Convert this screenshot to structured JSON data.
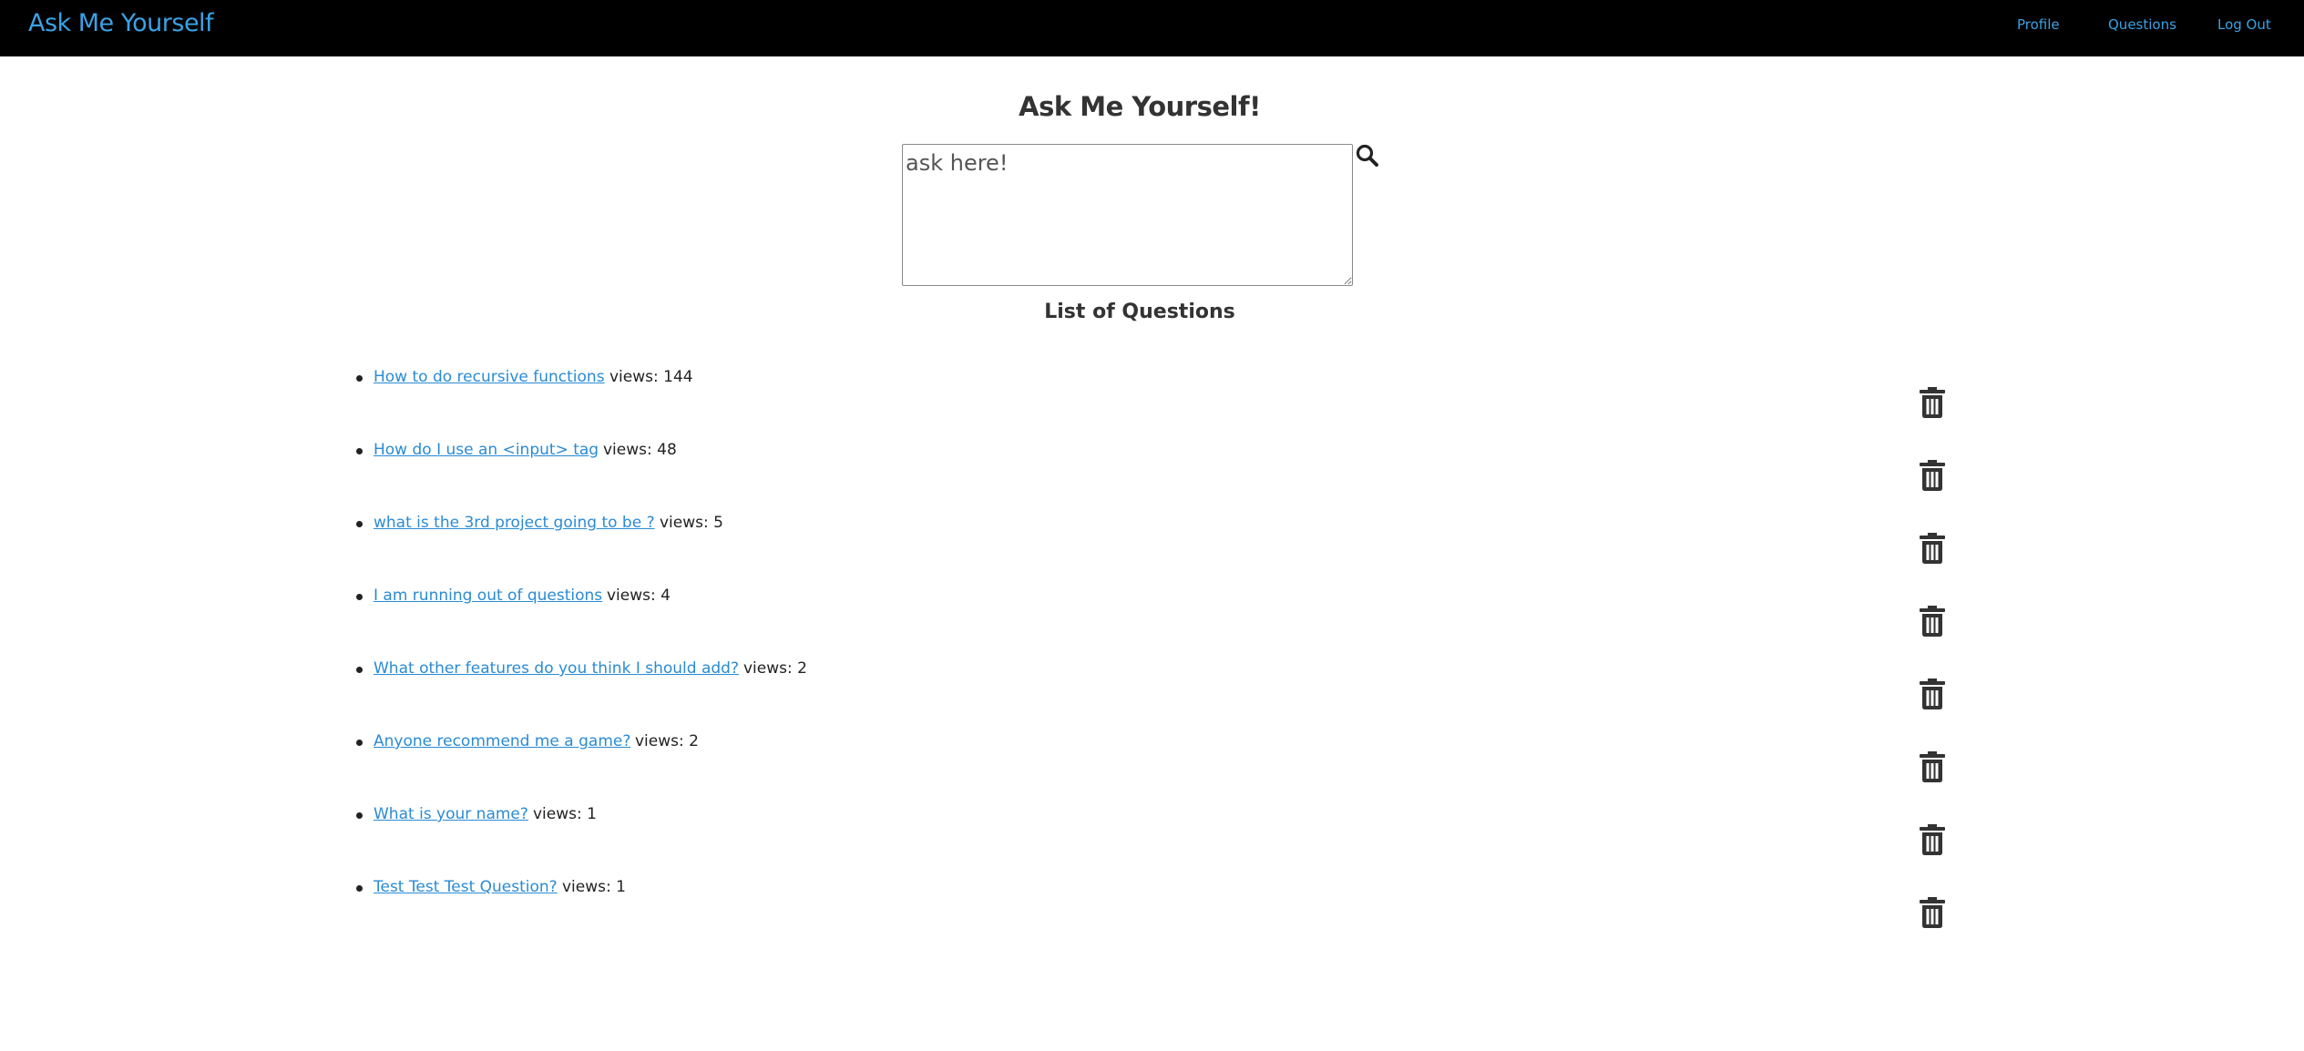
{
  "navbar": {
    "brand": "Ask Me Yourself",
    "links": [
      {
        "label": "Profile"
      },
      {
        "label": "Questions"
      },
      {
        "label": "Log Out"
      }
    ]
  },
  "main": {
    "title": "Ask Me Yourself!",
    "ask_placeholder": "ask here!",
    "search_icon": "search-icon",
    "list_heading": "List of Questions"
  },
  "questions": [
    {
      "title": "How to do recursive functions",
      "views": "views: 144"
    },
    {
      "title": "How do I use an <input> tag",
      "views": "views: 48"
    },
    {
      "title": "what is the 3rd project going to be ?",
      "views": "views: 5"
    },
    {
      "title": "I am running out of questions",
      "views": "views: 4"
    },
    {
      "title": "What other features do you think I should add?",
      "views": "views: 2"
    },
    {
      "title": "Anyone recommend me a game?",
      "views": "views: 2"
    },
    {
      "title": "What is your name?",
      "views": "views: 1"
    },
    {
      "title": "Test Test Test Question?",
      "views": "views: 1"
    }
  ],
  "icons": {
    "delete": "trash-icon"
  },
  "colors": {
    "navbar_bg": "#000000",
    "link": "#2a8bd4",
    "brand": "#3aa2e6",
    "icon": "#333333"
  }
}
